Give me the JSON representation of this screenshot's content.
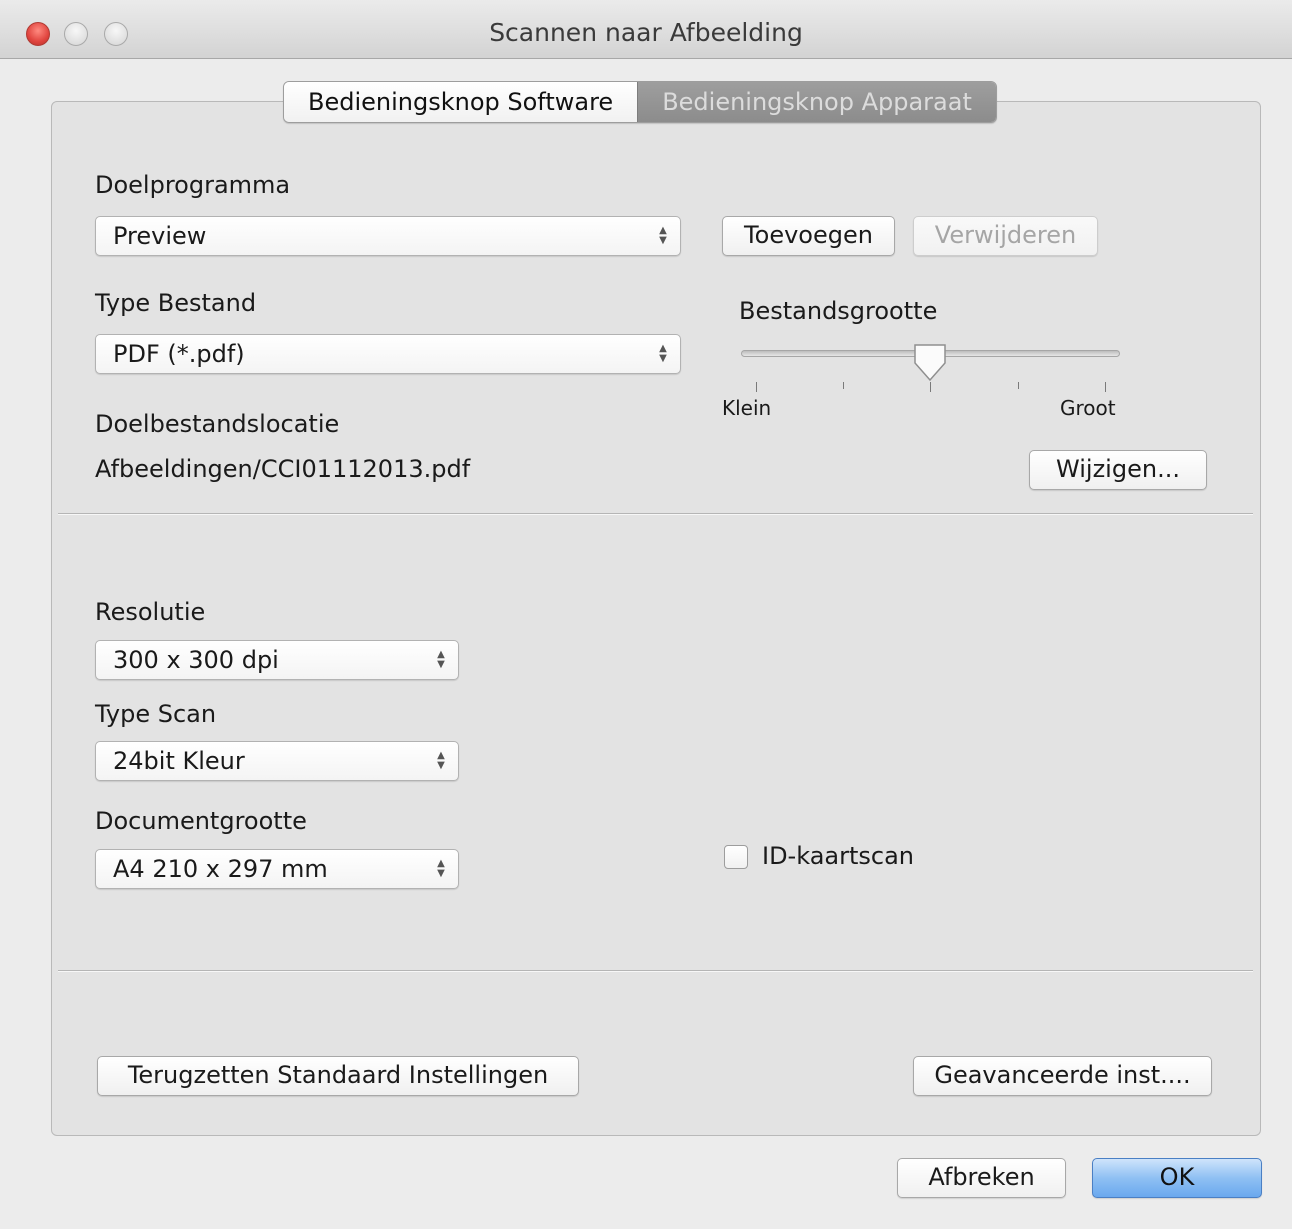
{
  "window": {
    "title": "Scannen naar Afbeelding"
  },
  "tabs": [
    {
      "label": "Bedieningsknop Software",
      "selected": true
    },
    {
      "label": "Bedieningsknop Apparaat",
      "selected": false
    }
  ],
  "target_app": {
    "label": "Doelprogramma",
    "value": "Preview",
    "add_button": "Toevoegen",
    "remove_button": "Verwijderen"
  },
  "file_type": {
    "label": "Type Bestand",
    "value": "PDF (*.pdf)"
  },
  "file_size": {
    "label": "Bestandsgrootte",
    "min_label": "Klein",
    "max_label": "Groot",
    "level": 0.5
  },
  "destination": {
    "label": "Doelbestandslocatie",
    "path": "Afbeeldingen/CCI01112013.pdf",
    "change_button": "Wijzigen..."
  },
  "resolution": {
    "label": "Resolutie",
    "value": "300 x 300 dpi"
  },
  "scan_type": {
    "label": "Type Scan",
    "value": "24bit Kleur"
  },
  "doc_size": {
    "label": "Documentgrootte",
    "value": "A4 210 x 297 mm"
  },
  "id_card": {
    "label": "ID-kaartscan",
    "checked": false
  },
  "footer": {
    "reset_button": "Terugzetten Standaard Instellingen",
    "advanced_button": "Geavanceerde inst....",
    "cancel_button": "Afbreken",
    "ok_button": "OK"
  }
}
